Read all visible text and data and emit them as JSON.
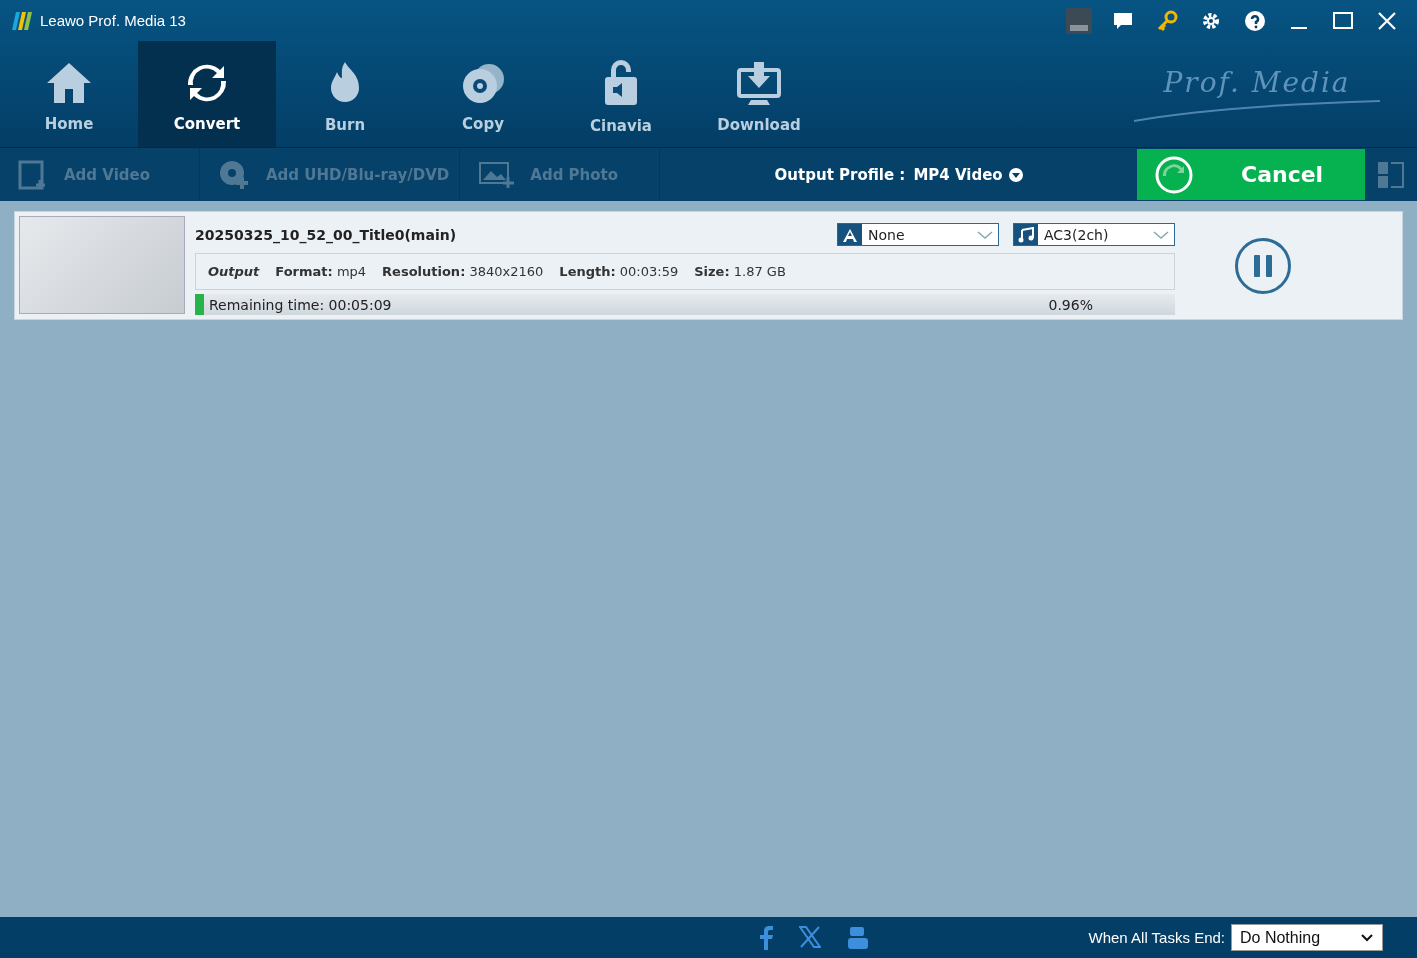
{
  "window": {
    "title": "Leawo Prof. Media 13"
  },
  "nav_tabs": [
    {
      "label": "Home",
      "selected": false
    },
    {
      "label": "Convert",
      "selected": true
    },
    {
      "label": "Burn",
      "selected": false
    },
    {
      "label": "Copy",
      "selected": false
    },
    {
      "label": "Cinavia",
      "selected": false
    },
    {
      "label": "Download",
      "selected": false
    }
  ],
  "brand_logo": "Prof. Media",
  "toolbar": {
    "items": [
      {
        "label": "Add Video"
      },
      {
        "label": "Add UHD/Blu-ray/DVD"
      },
      {
        "label": "Add Photo"
      }
    ],
    "output_profile_label": "Output Profile :",
    "output_profile_value": "MP4 Video",
    "cancel_label": "Cancel"
  },
  "task": {
    "title": "20250325_10_52_00_Title0(main)",
    "subtitle": "None",
    "audio": "AC3(2ch)",
    "output_label": "Output",
    "fields": [
      {
        "label": "Format:",
        "value": "mp4"
      },
      {
        "label": "Resolution:",
        "value": "3840x2160"
      },
      {
        "label": "Length:",
        "value": "00:03:59"
      },
      {
        "label": "Size:",
        "value": "1.87 GB"
      }
    ],
    "remaining": "Remaining time: 00:05:09",
    "percent": "0.96%",
    "level": 0.0096
  },
  "status_bar": {
    "label": "When All Tasks End:",
    "value": "Do Nothing"
  }
}
